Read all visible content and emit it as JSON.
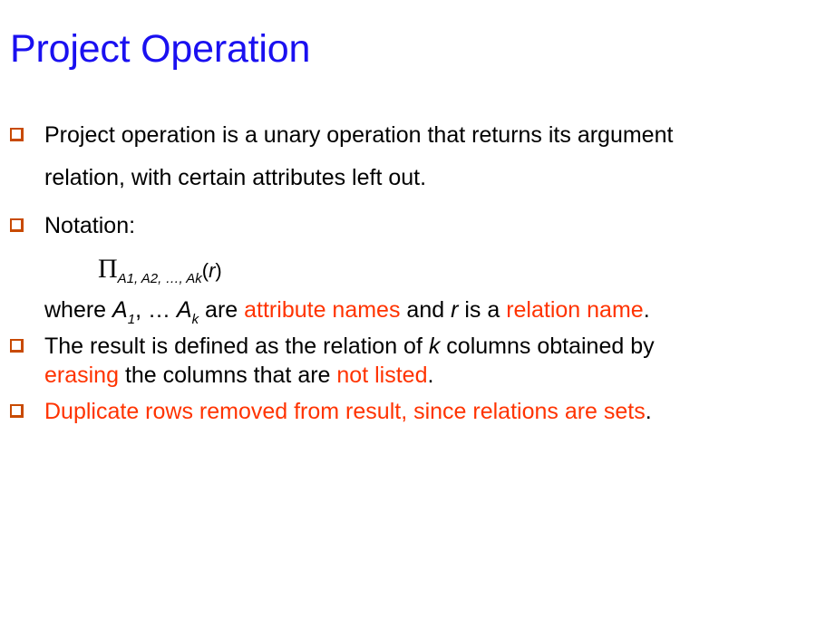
{
  "slide": {
    "title": "Project Operation",
    "bullet1": {
      "line1": "Project operation is a unary operation that returns its argument",
      "line2": "relation, with certain attributes left out."
    },
    "bullet2": {
      "label": "Notation:",
      "formula": {
        "symbol": "Π",
        "subscript": "A1, A2, …, Ak",
        "open_paren": "(",
        "arg": "r",
        "close_paren": ")"
      },
      "where": {
        "prefix": "where ",
        "a_symbol": "A",
        "sub_1": "1",
        "mid": ", … ",
        "a_symbol_2": "A",
        "sub_k": "k",
        "are": " are ",
        "attr_names": "attribute names",
        "and": " and ",
        "r": "r",
        "is_a": " is a ",
        "rel_name": "relation name",
        "period": "."
      }
    },
    "bullet3": {
      "line1_a": "The result is defined as the relation of ",
      "line1_k": "k",
      "line1_b": " columns obtained by",
      "line2_erasing": "erasing",
      "line2_mid": " the columns that are ",
      "line2_not_listed": "not listed",
      "line2_period": "."
    },
    "bullet4": {
      "text": "Duplicate rows removed from result, since relations are sets",
      "period": "."
    }
  },
  "colors": {
    "title": "#1a10f0",
    "highlight": "#ff3300",
    "bullet": "#c84a00",
    "text": "#000000"
  }
}
